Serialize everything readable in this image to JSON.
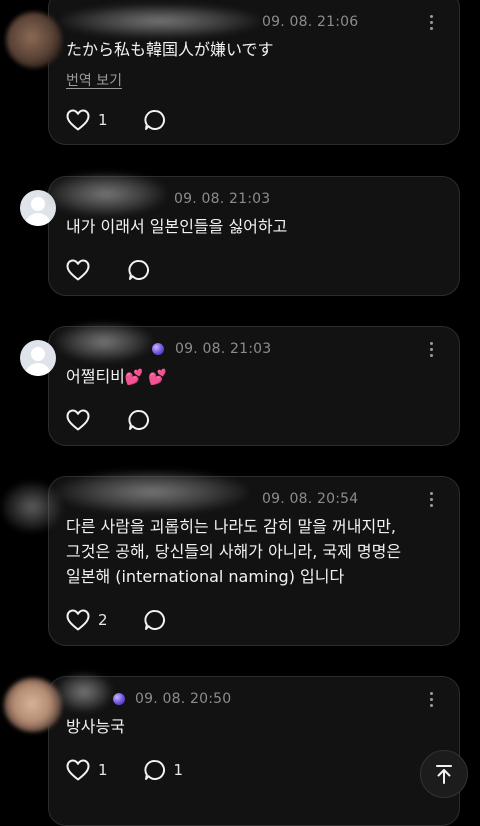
{
  "comments": [
    {
      "date": "09. 08. 21:06",
      "lines": [
        "たから私も韓国人が嫌いです"
      ],
      "translate_label": "번역 보기",
      "like_count": "1",
      "reply_count": ""
    },
    {
      "date": "09. 08. 21:03",
      "lines": [
        "내가 이래서 일본인들을 싫어하고"
      ],
      "like_count": "",
      "reply_count": ""
    },
    {
      "date": "09. 08. 21:03",
      "lines": [
        "어쩔티비"
      ],
      "emoji": "💕 💕",
      "like_count": "",
      "reply_count": ""
    },
    {
      "date": "09. 08. 20:54",
      "lines": [
        "다른 사람을 괴롭히는 나라도 감히 말을 꺼내지만,",
        "그것은 공해, 당신들의 사해가 아니라, 국제 명명은",
        "일본해 (international naming) 입니다"
      ],
      "like_count": "2",
      "reply_count": ""
    },
    {
      "date": "09. 08. 20:50",
      "lines": [
        "방사능국"
      ],
      "like_count": "1",
      "reply_count": "1"
    }
  ],
  "icons": {
    "like": "heart-icon",
    "reply": "comment-bubble-icon",
    "more": "more-vertical-icon",
    "scroll_top": "arrow-up-icon"
  },
  "colors": {
    "background": "#000000",
    "card": "#121212",
    "card_border": "#2c2c2c",
    "meta_text": "#8c8c8c",
    "body_text": "#f2f2f2",
    "verified_badge": "#6b4fe0"
  }
}
